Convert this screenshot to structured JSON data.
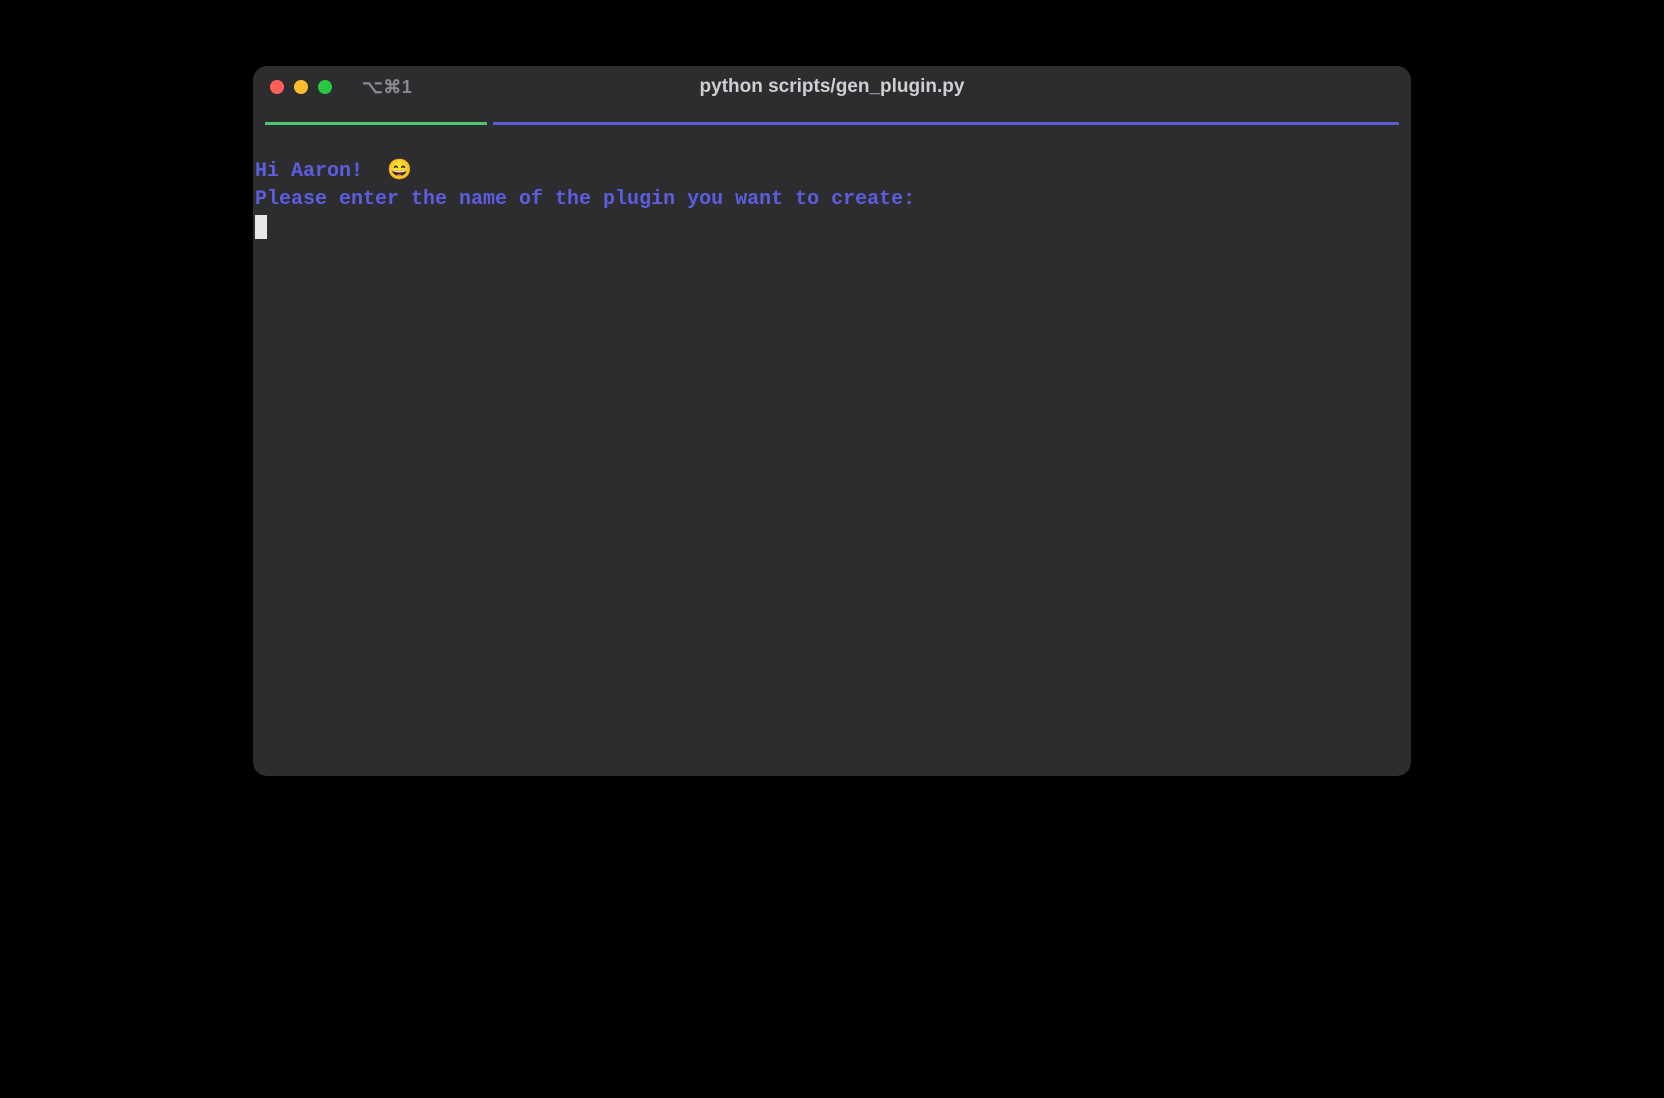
{
  "window": {
    "title": "python scripts/gen_plugin.py",
    "tab_label": "⌥⌘1"
  },
  "content": {
    "greeting": "Hi Aaron!",
    "emoji": "😄",
    "prompt": "Please enter the name of the plugin you want to create:"
  },
  "colors": {
    "text_blue": "#5b5ee0",
    "tab_active": "#4ec86f",
    "tab_inactive": "#5a5cd6",
    "background": "#2d2d30"
  }
}
